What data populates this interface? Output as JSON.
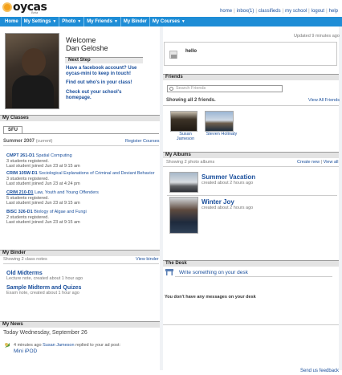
{
  "brand": {
    "name": "oycas",
    "tag": "Beta"
  },
  "topnav": [
    "home",
    "inbox(1)",
    "classifieds",
    "my school",
    "logout",
    "help"
  ],
  "menu": [
    "Home",
    "My Settings",
    "Photo",
    "My Friends",
    "My Binder",
    "My Courses"
  ],
  "profile": {
    "welcome": "Welcome",
    "name": "Dan Geloshe",
    "next_step": "Next Step",
    "steps": [
      "Have a facebook account? Use oycas-mini to keep in touch!",
      "Find out who's in your class!",
      "Check out your school's homepage."
    ]
  },
  "status": {
    "updated": "Updated 9 minutes ago",
    "text": "hello"
  },
  "classes": {
    "title": "My Classes",
    "tab": "SFU",
    "term": "Summer 2007",
    "term_note": "(current)",
    "register": "Register Courses",
    "courses": [
      {
        "code": "CMPT 261-D1",
        "name": "Spatial Computing",
        "students": "3 students registered.",
        "last": "Last student joined Jun 23 at 9:15 am"
      },
      {
        "code": "CRIM 105W-D1",
        "name": "Sociological Explanations of Criminal and Deviant Behavior",
        "students": "3 students registered.",
        "last": "Last student joined Jun 23 at 4:24 pm"
      },
      {
        "code": "CRIM 210-D1",
        "name": "Law, Youth and Young Offenders",
        "students": "5 students registered.",
        "last": "Last student joined Jun 23 at 9:15 am"
      },
      {
        "code": "BISC 326-D1",
        "name": "Biology of Algae and Fungi",
        "students": "2 students registered.",
        "last": "Last student joined Jun 23 at 9:15 am"
      }
    ]
  },
  "friends": {
    "title": "Friends",
    "search_placeholder": "Search Friends",
    "showing": "Showing all 2 friends.",
    "view_all": "View All Friends",
    "list": [
      {
        "name": "Susan Jameson"
      },
      {
        "name": "Steven Holinaty"
      }
    ]
  },
  "albums": {
    "title": "My Albums",
    "showing": "Showing 2 photo albums",
    "create": "Create new",
    "view_all": "View all",
    "list": [
      {
        "title": "Summer Vacation",
        "meta": "created about 2 hours ago"
      },
      {
        "title": "Winter Joy",
        "meta": "created about 2 hours ago"
      }
    ]
  },
  "binder": {
    "title": "My Binder",
    "showing": "Showing 2 class notes",
    "view": "View binder",
    "notes": [
      {
        "title": "Old Midterms",
        "meta": "Lecture note, created about 1 hour ago"
      },
      {
        "title": "Sample Midterm and Quizes",
        "meta": "Exam note, created about 1 hour ago"
      }
    ]
  },
  "desk": {
    "title": "The Desk",
    "write": "Write something on your desk",
    "empty": "You don't have any messages on your desk"
  },
  "news": {
    "title": "My News",
    "day": "Today Wednesday, September 26",
    "time": "4 minutes ago",
    "user": "Susan Jameson",
    "action": "replied to your ad post:",
    "item": "Mini iPOD"
  },
  "footer": {
    "feedback": "Send us feedback"
  },
  "colors": {
    "menu_blue": "#1e8dd6",
    "link": "#1a4f9c",
    "logo_orange": "#f4a11b"
  }
}
